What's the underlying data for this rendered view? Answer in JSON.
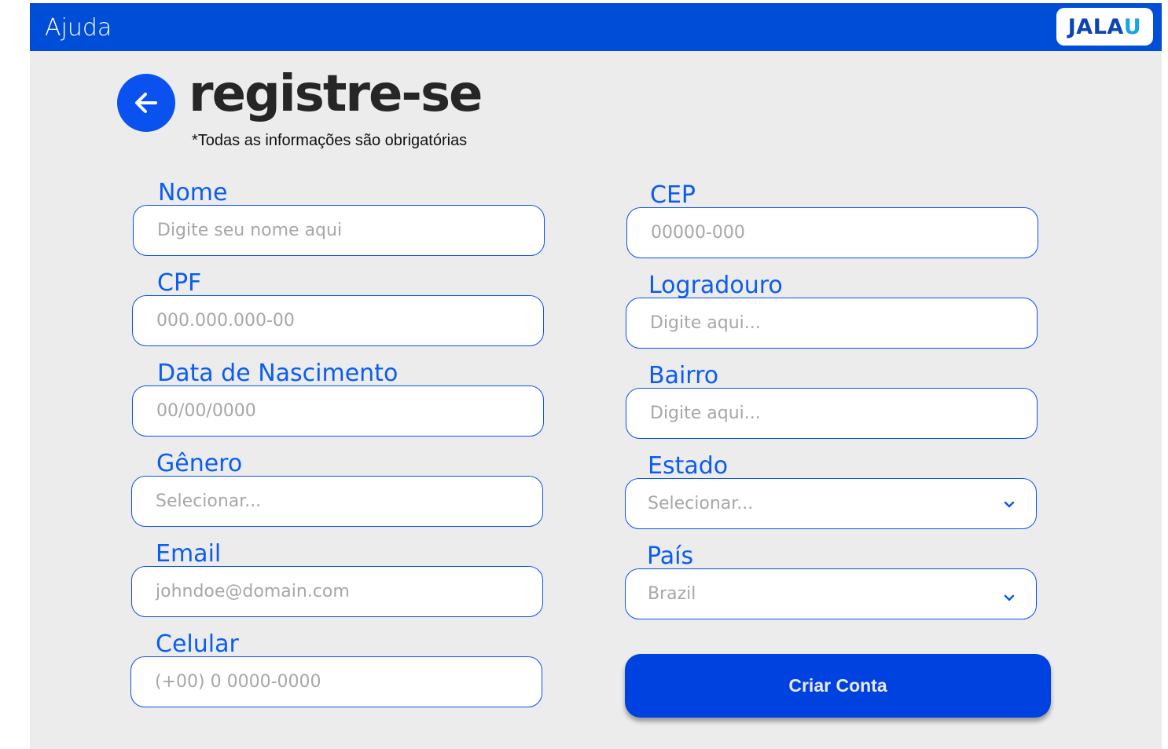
{
  "header": {
    "help_label": "Ajuda",
    "logo_text": "JALA",
    "logo_accent": "U"
  },
  "page": {
    "title": "registre-se",
    "subtitle": "*Todas as informações são obrigatórias"
  },
  "form": {
    "nome": {
      "label": "Nome",
      "placeholder": "Digite seu nome aqui"
    },
    "cpf": {
      "label": "CPF",
      "placeholder": "000.000.000-00"
    },
    "nascimento": {
      "label": "Data de Nascimento",
      "placeholder": "00/00/0000"
    },
    "genero": {
      "label": "Gênero",
      "placeholder": "Selecionar..."
    },
    "email": {
      "label": "Email",
      "placeholder": "johndoe@domain.com"
    },
    "celular": {
      "label": "Celular",
      "placeholder": "(+00) 0 0000-0000"
    },
    "cep": {
      "label": "CEP",
      "placeholder": "00000-000"
    },
    "logradouro": {
      "label": "Logradouro",
      "placeholder": "Digite aqui..."
    },
    "bairro": {
      "label": "Bairro",
      "placeholder": "Digite aqui..."
    },
    "estado": {
      "label": "Estado",
      "selected": "Selecionar..."
    },
    "pais": {
      "label": "País",
      "selected": "Brazil"
    },
    "submit_label": "Criar Conta"
  },
  "colors": {
    "header_bg": "#004ed8",
    "accent": "#0b5cf2",
    "button_bg": "#0042e0",
    "page_bg": "#ececec"
  }
}
